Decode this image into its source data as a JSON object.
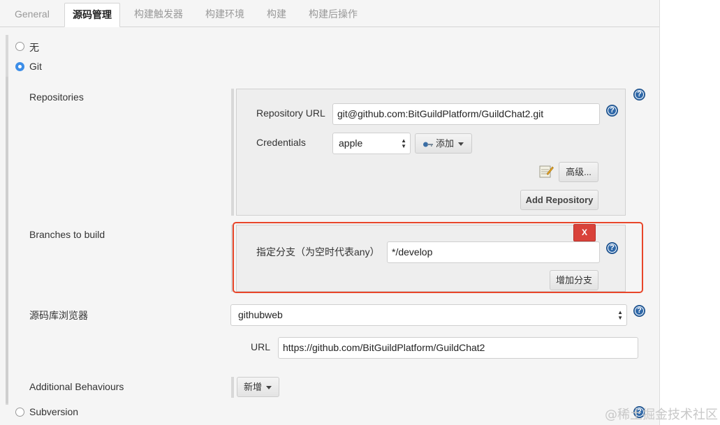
{
  "tabs": [
    "General",
    "源码管理",
    "构建触发器",
    "构建环境",
    "构建",
    "构建后操作"
  ],
  "active_tab": "源码管理",
  "scm": {
    "option_none": "无",
    "option_git": "Git",
    "option_subversion": "Subversion",
    "selected": "Git"
  },
  "repositories": {
    "label": "Repositories",
    "url_label": "Repository URL",
    "url_value": "git@github.com:BitGuildPlatform/GuildChat2.git",
    "credentials_label": "Credentials",
    "credentials_value": "apple",
    "add_button": "添加",
    "advanced_button": "高级...",
    "add_repository_button": "Add Repository"
  },
  "branches": {
    "label": "Branches to build",
    "specifier_label": "指定分支（为空时代表any）",
    "specifier_value": "*/develop",
    "delete_button": "X",
    "add_branch_button": "增加分支"
  },
  "browser": {
    "label": "源码库浏览器",
    "value": "githubweb",
    "url_label": "URL",
    "url_value": "https://github.com/BitGuildPlatform/GuildChat2"
  },
  "additional": {
    "label": "Additional Behaviours",
    "add_button": "新增"
  },
  "help_icon_text": "?",
  "watermark": "@稀土掘金技术社区",
  "colors": {
    "accent": "#3d8ee8",
    "highlight_frame": "#e8462a",
    "delete_button": "#d9423a",
    "help_icon": "#2f68a8"
  }
}
